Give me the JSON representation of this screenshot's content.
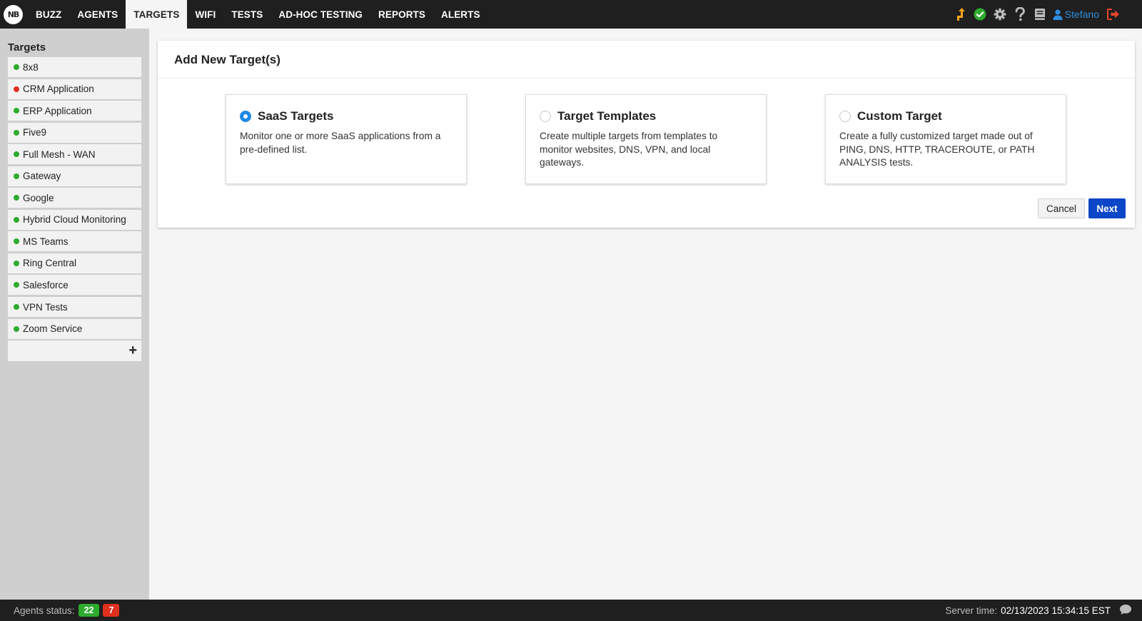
{
  "app": {
    "logo_text": "NB"
  },
  "nav": {
    "items": [
      {
        "label": "BUZZ"
      },
      {
        "label": "AGENTS"
      },
      {
        "label": "TARGETS",
        "active": true
      },
      {
        "label": "WIFI"
      },
      {
        "label": "TESTS"
      },
      {
        "label": "AD-HOC TESTING"
      },
      {
        "label": "REPORTS"
      },
      {
        "label": "ALERTS"
      }
    ],
    "right_icons": [
      "upgrade-arrow-icon",
      "status-check-icon",
      "gear-icon",
      "help-icon",
      "docs-book-icon"
    ],
    "user_name": "Stefano",
    "logout_icon": "logout-icon"
  },
  "sidebar": {
    "title": "Targets",
    "items": [
      {
        "label": "8x8",
        "status": "green"
      },
      {
        "label": "CRM Application",
        "status": "red"
      },
      {
        "label": "ERP Application",
        "status": "green"
      },
      {
        "label": "Five9",
        "status": "green"
      },
      {
        "label": "Full Mesh - WAN",
        "status": "green"
      },
      {
        "label": "Gateway",
        "status": "green"
      },
      {
        "label": "Google",
        "status": "green"
      },
      {
        "label": "Hybrid Cloud Monitoring",
        "status": "green"
      },
      {
        "label": "MS Teams",
        "status": "green"
      },
      {
        "label": "Ring Central",
        "status": "green"
      },
      {
        "label": "Salesforce",
        "status": "green"
      },
      {
        "label": "VPN Tests",
        "status": "green"
      },
      {
        "label": "Zoom Service",
        "status": "green"
      }
    ],
    "add_label": "+"
  },
  "main": {
    "title": "Add New Target(s)",
    "options": [
      {
        "title": "SaaS Targets",
        "description": "Monitor one or more SaaS applications from a pre-defined list.",
        "selected": true
      },
      {
        "title": "Target Templates",
        "description": "Create multiple targets from templates to monitor websites, DNS, VPN, and local gateways.",
        "selected": false
      },
      {
        "title": "Custom Target",
        "description": "Create a fully customized target made out of PING, DNS, HTTP, TRACEROUTE, or PATH ANALYSIS tests.",
        "selected": false
      }
    ],
    "cancel_label": "Cancel",
    "next_label": "Next"
  },
  "footer": {
    "agents_status_label": "Agents status:",
    "agents_ok": "22",
    "agents_down": "7",
    "server_time_label": "Server time:",
    "server_time": "02/13/2023 15:34:15 EST"
  },
  "colors": {
    "status_green": "#2dab2d",
    "status_red": "#e0301e",
    "accent_blue": "#0a46c7",
    "radio_blue": "#1e88e5",
    "user_blue": "#2e8cdd",
    "upgrade_orange": "#f4a21b",
    "logout_red": "#e0462a"
  }
}
